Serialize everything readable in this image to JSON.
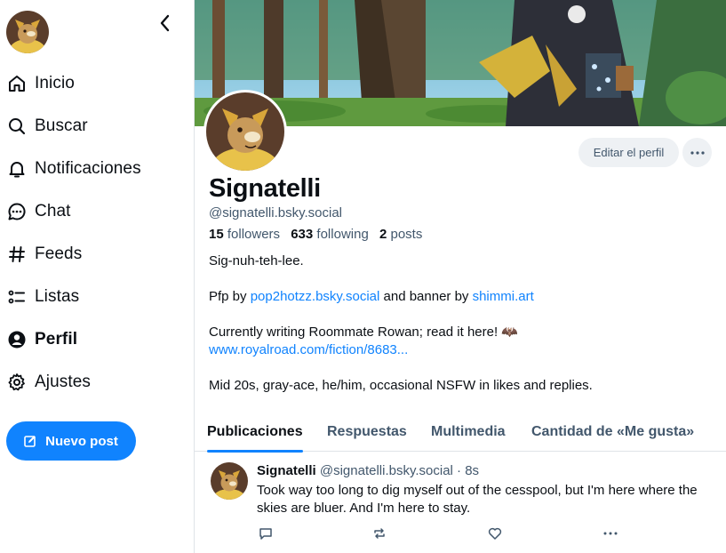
{
  "sidebar": {
    "nav": [
      {
        "label": "Inicio",
        "icon": "home-icon"
      },
      {
        "label": "Buscar",
        "icon": "search-icon"
      },
      {
        "label": "Notificaciones",
        "icon": "bell-icon"
      },
      {
        "label": "Chat",
        "icon": "chat-bubble-icon"
      },
      {
        "label": "Feeds",
        "icon": "hashtag-icon"
      },
      {
        "label": "Listas",
        "icon": "list-icon"
      },
      {
        "label": "Perfil",
        "icon": "user-circle-icon",
        "active": true
      },
      {
        "label": "Ajustes",
        "icon": "gear-icon"
      }
    ],
    "new_post_label": "Nuevo post"
  },
  "profile": {
    "display_name": "Signatelli",
    "handle": "@signatelli.bsky.social",
    "followers_count": "15",
    "followers_label": "followers",
    "following_count": "633",
    "following_label": "following",
    "posts_count": "2",
    "posts_label": "posts",
    "edit_label": "Editar el perfil",
    "bio": {
      "line1": "Sig-nuh-teh-lee.",
      "line2_prefix": "Pfp by ",
      "line2_link1": "pop2hotzz.bsky.social",
      "line2_middle": " and banner by ",
      "line2_link2": "shimmi.art",
      "line3": "Currently writing Roommate Rowan; read it here! 🦇",
      "line3_link": "www.royalroad.com/fiction/8683...",
      "line4": "Mid 20s, gray-ace, he/him, occasional NSFW in likes and replies."
    }
  },
  "tabs": [
    "Publicaciones",
    "Respuestas",
    "Multimedia",
    "Cantidad de «Me gusta»"
  ],
  "post": {
    "author": "Signatelli",
    "handle": "@signatelli.bsky.social",
    "separator": " · ",
    "time": "8s",
    "text": "Took way too long to dig myself out of the cesspool, but I'm here where the skies are bluer. And I'm here to stay."
  },
  "colors": {
    "accent": "#1083fe",
    "muted_text": "#42576c",
    "border": "#dfe3e8"
  }
}
